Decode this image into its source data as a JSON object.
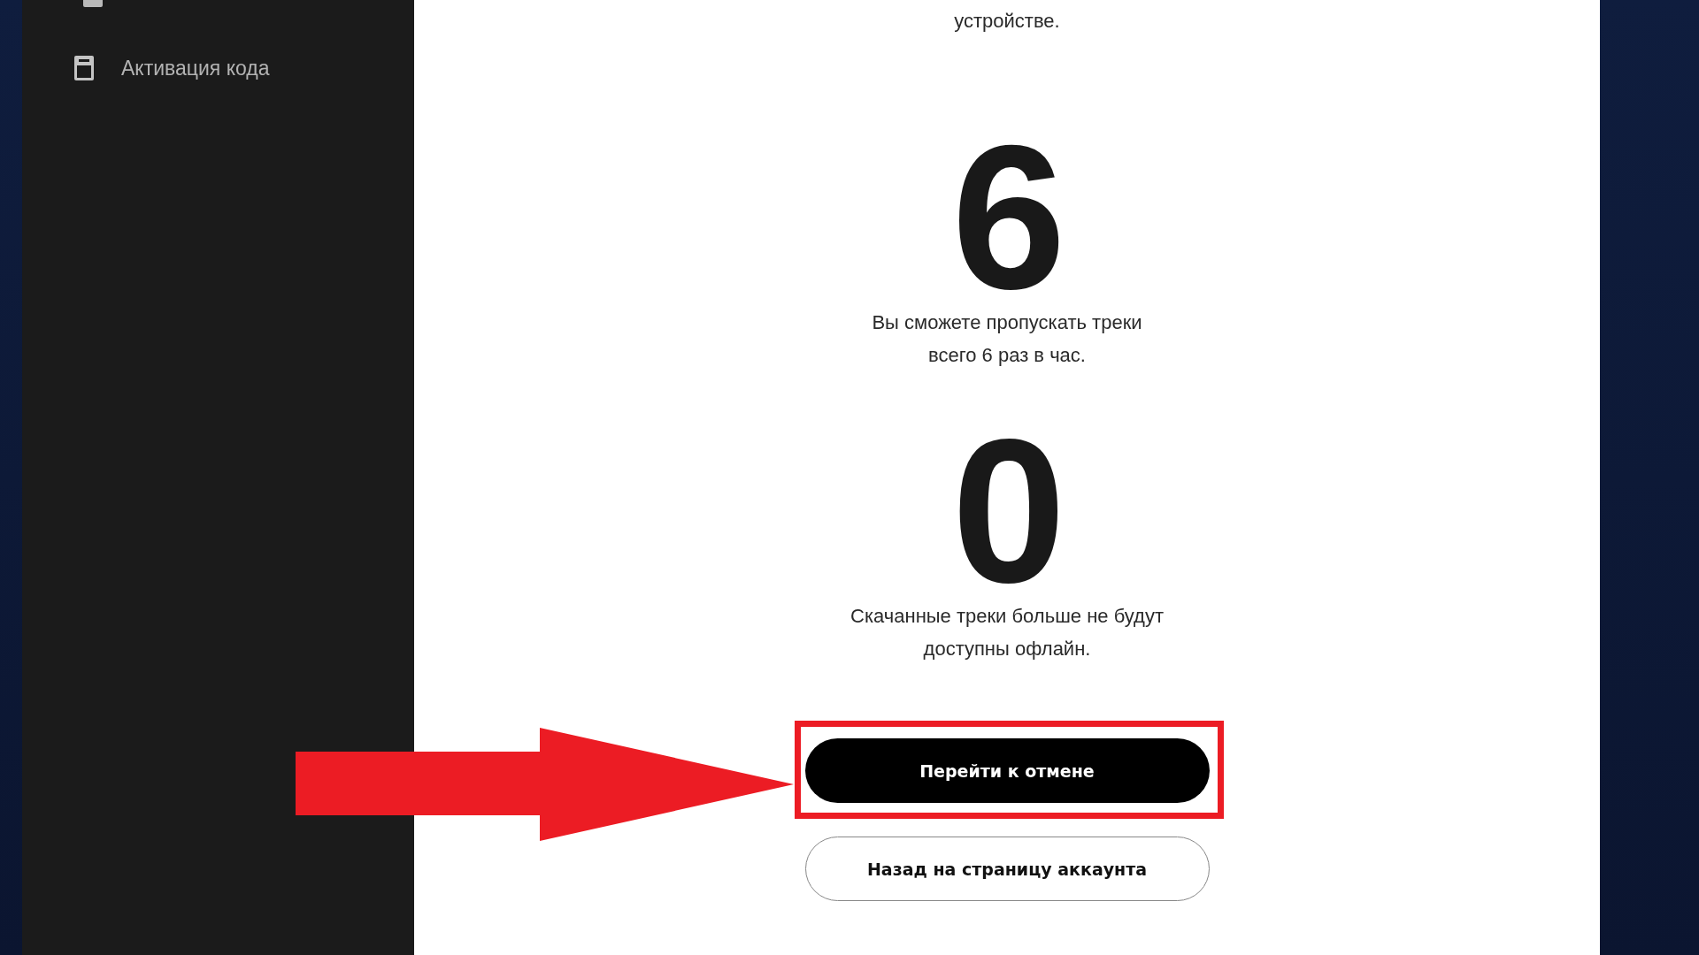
{
  "sidebar": {
    "items": [
      {
        "label": "Активация кода",
        "selected": false
      }
    ]
  },
  "intro_tail": "устройстве.",
  "stats": [
    {
      "value": "6",
      "text": "Вы сможете пропускать треки\nвсего 6 раз в час."
    },
    {
      "value": "0",
      "text": "Скачанные треки больше не будут\nдоступны офлайн."
    }
  ],
  "buttons": [
    {
      "label": "Перейти к отмене",
      "kind": "primary"
    },
    {
      "label": "Назад на страницу аккаунта",
      "kind": "secondary"
    }
  ]
}
